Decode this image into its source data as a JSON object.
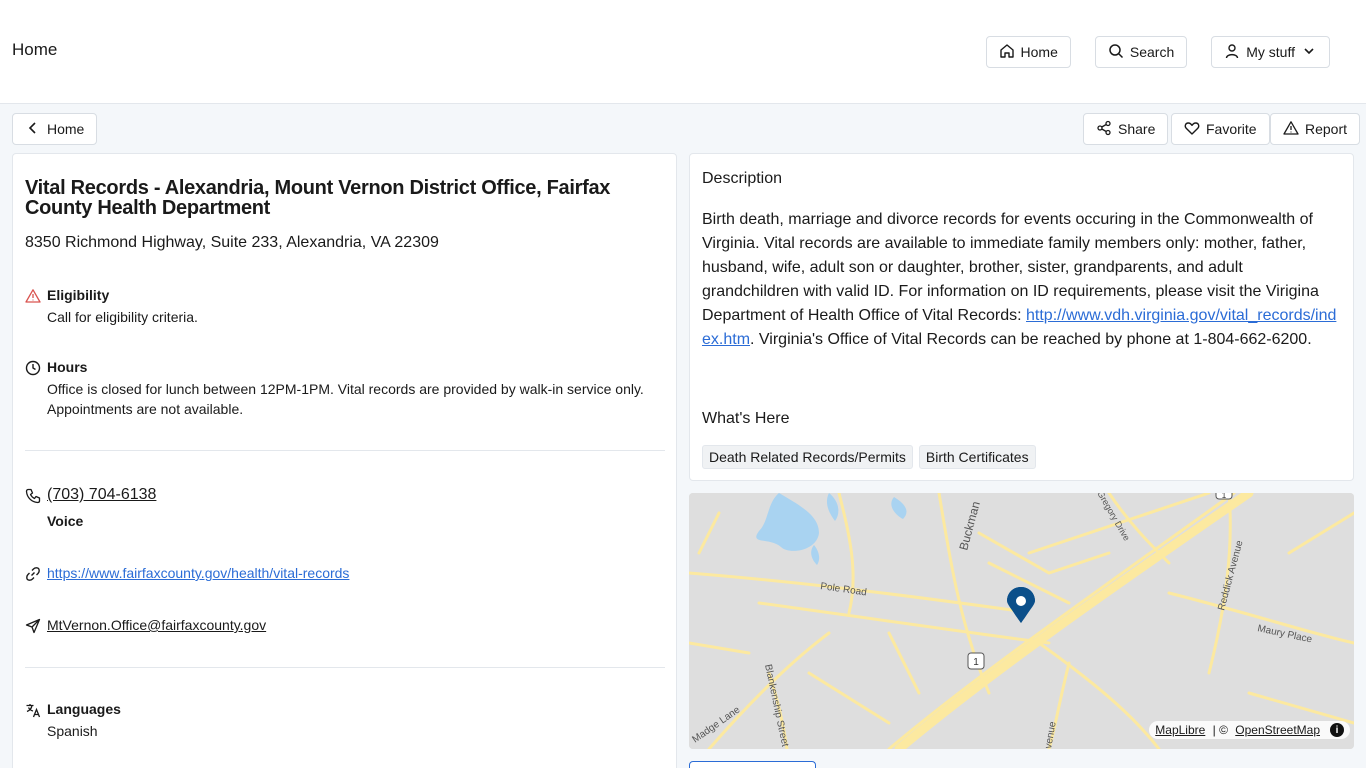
{
  "header": {
    "logo_alt": "Home",
    "nav": {
      "home": "Home",
      "search": "Search",
      "my_stuff": "My stuff"
    }
  },
  "subbar": {
    "back": "Home",
    "share": "Share",
    "favorite": "Favorite",
    "report": "Report"
  },
  "listing": {
    "title": "Vital Records - Alexandria, Mount Vernon District Office, Fairfax County Health Department",
    "address": "8350 Richmond Highway, Suite 233, Alexandria, VA 22309",
    "eligibility_label": "Eligibility",
    "eligibility_text": "Call for eligibility criteria.",
    "hours_label": "Hours",
    "hours_text": "Office is closed for lunch between 12PM-1PM. Vital records are provided by walk-in service only. Appointments are not available.",
    "phone": "(703) 704-6138",
    "phone_type": "Voice",
    "website": "https://www.fairfaxcounty.gov/health/vital-records",
    "email": "MtVernon.Office@fairfaxcounty.gov",
    "languages_label": "Languages",
    "languages_text": "Spanish"
  },
  "description": {
    "heading": "Description",
    "text_before": "Birth death, marriage and divorce records for events occuring in the Commonwealth of Virginia. Vital records are available to immediate family members only: mother, father, husband, wife, adult son or daughter, brother, sister, grandparents, and adult grandchildren with valid ID. For information on ID requirements, please visit the Virigina Department of Health Office of Vital Records: ",
    "link": "http://www.vdh.virginia.gov/vital_records/index.htm",
    "text_after": ". Virginia's Office of Vital Records can be reached by phone at 1-804-662-6200.",
    "whats_here": "What's Here",
    "tags": [
      "Death Related Records/Permits",
      "Birth Certificates"
    ]
  },
  "map": {
    "labels": {
      "buckman": "Buckman",
      "gregory": "Gregory Drive",
      "pole": "Pole Road",
      "reddick": "Reddick Avenue",
      "maury": "Maury Place",
      "blankenship": "Blankenship Street",
      "madge": "Madge Lane",
      "avenue": "venue",
      "route": "1",
      "route_top": "1"
    },
    "attribution": {
      "maplibre": "MapLibre",
      "sep": " | © ",
      "osm": "OpenStreetMap",
      "info": "i"
    },
    "colors": {
      "land": "#dedede",
      "road": "#fce9a0",
      "water": "#a9d3f1",
      "marker": "#0b4f8a"
    }
  }
}
